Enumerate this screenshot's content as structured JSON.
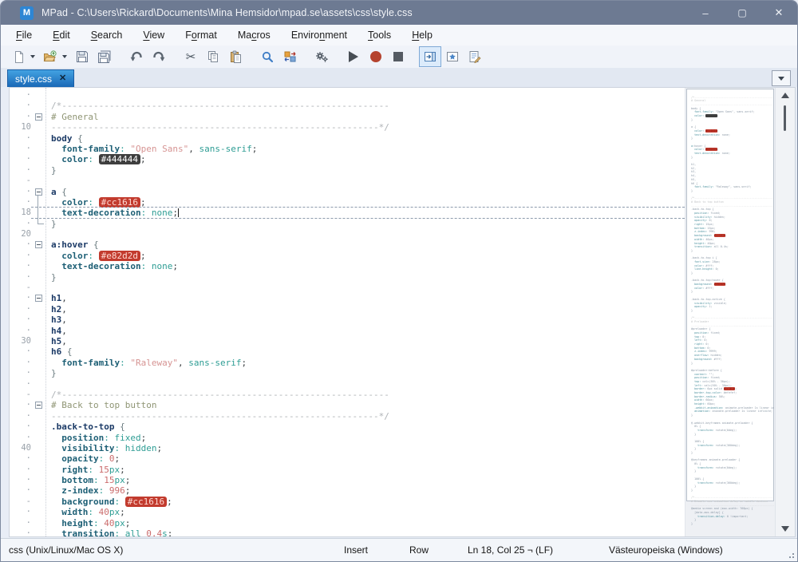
{
  "window": {
    "title": "MPad - C:\\Users\\Rickard\\Documents\\Mina Hemsidor\\mpad.se\\assets\\css\\style.css",
    "logo_text": "M",
    "controls": {
      "minimize": "–",
      "maximize": "▢",
      "close": "✕"
    }
  },
  "menu": {
    "items": [
      {
        "label": "File",
        "underline": 0
      },
      {
        "label": "Edit",
        "underline": 0
      },
      {
        "label": "Search",
        "underline": 0
      },
      {
        "label": "View",
        "underline": 0
      },
      {
        "label": "Format",
        "underline": 1
      },
      {
        "label": "Macros",
        "underline": 2
      },
      {
        "label": "Environment",
        "underline": 6
      },
      {
        "label": "Tools",
        "underline": 0
      },
      {
        "label": "Help",
        "underline": 0
      }
    ]
  },
  "toolbar": {
    "icons": [
      "new-file",
      "new-file-dropdown",
      "open-file",
      "open-file-dropdown",
      "save",
      "save-all",
      "undo",
      "redo",
      "cut",
      "copy",
      "paste",
      "find",
      "replace",
      "macro-settings",
      "run",
      "record-macro",
      "stop",
      "side-panel-toggle",
      "bookmark-panel",
      "edit-settings"
    ]
  },
  "tabbar": {
    "active_tab": "style.css",
    "close_glyph": "✕"
  },
  "editor": {
    "lines": [
      {
        "n": 7,
        "k": []
      },
      {
        "n": 8,
        "k": [
          [
            "c",
            "/*--------------------------------------------------------------"
          ]
        ]
      },
      {
        "n": 9,
        "fold": true,
        "k": [
          [
            "h",
            "# General"
          ]
        ]
      },
      {
        "n": 10,
        "k": [
          [
            "c",
            "--------------------------------------------------------------*/"
          ]
        ]
      },
      {
        "n": 11,
        "k": [
          [
            "e",
            "body"
          ],
          [
            "t",
            " "
          ],
          [
            "b",
            "{"
          ]
        ]
      },
      {
        "n": 12,
        "k": [
          [
            "t",
            "  "
          ],
          [
            "p",
            "font-family"
          ],
          [
            "o",
            ":"
          ],
          [
            "t",
            " "
          ],
          [
            "s",
            "\"Open Sans\""
          ],
          [
            "m",
            ","
          ],
          [
            "t",
            " "
          ],
          [
            "v",
            "sans-serif"
          ],
          [
            "m",
            ";"
          ]
        ]
      },
      {
        "n": 13,
        "k": [
          [
            "t",
            "  "
          ],
          [
            "p",
            "color"
          ],
          [
            "o",
            ":"
          ],
          [
            "t",
            " "
          ],
          [
            "kd",
            "#444444"
          ],
          [
            "m",
            ";"
          ]
        ]
      },
      {
        "n": 14,
        "k": [
          [
            "b",
            "}"
          ]
        ]
      },
      {
        "n": 15,
        "k": []
      },
      {
        "n": 16,
        "fold": true,
        "k": [
          [
            "e",
            "a"
          ],
          [
            "t",
            " "
          ],
          [
            "b",
            "{"
          ]
        ]
      },
      {
        "n": 17,
        "k": [
          [
            "t",
            "  "
          ],
          [
            "p",
            "color"
          ],
          [
            "o",
            ":"
          ],
          [
            "t",
            " "
          ],
          [
            "kr",
            "#cc1616"
          ],
          [
            "m",
            ";"
          ]
        ]
      },
      {
        "n": 18,
        "cur": true,
        "caret": true,
        "k": [
          [
            "t",
            "  "
          ],
          [
            "p",
            "text-decoration"
          ],
          [
            "o",
            ":"
          ],
          [
            "t",
            " "
          ],
          [
            "v",
            "none"
          ],
          [
            "m",
            ";"
          ]
        ]
      },
      {
        "n": 19,
        "k": [
          [
            "b",
            "}"
          ]
        ]
      },
      {
        "n": 20,
        "k": []
      },
      {
        "n": 21,
        "fold": true,
        "k": [
          [
            "e",
            "a:hover"
          ],
          [
            "t",
            " "
          ],
          [
            "b",
            "{"
          ]
        ]
      },
      {
        "n": 22,
        "k": [
          [
            "t",
            "  "
          ],
          [
            "p",
            "color"
          ],
          [
            "o",
            ":"
          ],
          [
            "t",
            " "
          ],
          [
            "kr",
            "#e82d2d"
          ],
          [
            "m",
            ";"
          ]
        ]
      },
      {
        "n": 23,
        "k": [
          [
            "t",
            "  "
          ],
          [
            "p",
            "text-decoration"
          ],
          [
            "o",
            ":"
          ],
          [
            "t",
            " "
          ],
          [
            "v",
            "none"
          ],
          [
            "m",
            ";"
          ]
        ]
      },
      {
        "n": 24,
        "k": [
          [
            "b",
            "}"
          ]
        ]
      },
      {
        "n": 25,
        "k": []
      },
      {
        "n": 26,
        "fold": true,
        "k": [
          [
            "e",
            "h1"
          ],
          [
            "m",
            ","
          ]
        ]
      },
      {
        "n": 27,
        "k": [
          [
            "e",
            "h2"
          ],
          [
            "m",
            ","
          ]
        ]
      },
      {
        "n": 28,
        "k": [
          [
            "e",
            "h3"
          ],
          [
            "m",
            ","
          ]
        ]
      },
      {
        "n": 29,
        "k": [
          [
            "e",
            "h4"
          ],
          [
            "m",
            ","
          ]
        ]
      },
      {
        "n": 30,
        "k": [
          [
            "e",
            "h5"
          ],
          [
            "m",
            ","
          ]
        ]
      },
      {
        "n": 31,
        "k": [
          [
            "e",
            "h6"
          ],
          [
            "t",
            " "
          ],
          [
            "b",
            "{"
          ]
        ]
      },
      {
        "n": 32,
        "k": [
          [
            "t",
            "  "
          ],
          [
            "p",
            "font-family"
          ],
          [
            "o",
            ":"
          ],
          [
            "t",
            " "
          ],
          [
            "s",
            "\"Raleway\""
          ],
          [
            "m",
            ","
          ],
          [
            "t",
            " "
          ],
          [
            "v",
            "sans-serif"
          ],
          [
            "m",
            ";"
          ]
        ]
      },
      {
        "n": 33,
        "k": [
          [
            "b",
            "}"
          ]
        ]
      },
      {
        "n": 34,
        "k": []
      },
      {
        "n": 35,
        "k": [
          [
            "c",
            "/*--------------------------------------------------------------"
          ]
        ]
      },
      {
        "n": 36,
        "fold": true,
        "k": [
          [
            "h",
            "# Back to top button"
          ]
        ]
      },
      {
        "n": 37,
        "k": [
          [
            "c",
            "--------------------------------------------------------------*/"
          ]
        ]
      },
      {
        "n": 38,
        "k": [
          [
            "e",
            ".back-to-top"
          ],
          [
            "t",
            " "
          ],
          [
            "b",
            "{"
          ]
        ]
      },
      {
        "n": 39,
        "k": [
          [
            "t",
            "  "
          ],
          [
            "p",
            "position"
          ],
          [
            "o",
            ":"
          ],
          [
            "t",
            " "
          ],
          [
            "v",
            "fixed"
          ],
          [
            "m",
            ";"
          ]
        ]
      },
      {
        "n": 40,
        "k": [
          [
            "t",
            "  "
          ],
          [
            "p",
            "visibility"
          ],
          [
            "o",
            ":"
          ],
          [
            "t",
            " "
          ],
          [
            "v",
            "hidden"
          ],
          [
            "m",
            ";"
          ]
        ]
      },
      {
        "n": 41,
        "k": [
          [
            "t",
            "  "
          ],
          [
            "p",
            "opacity"
          ],
          [
            "o",
            ":"
          ],
          [
            "t",
            " "
          ],
          [
            "n",
            "0"
          ],
          [
            "m",
            ";"
          ]
        ]
      },
      {
        "n": 42,
        "k": [
          [
            "t",
            "  "
          ],
          [
            "p",
            "right"
          ],
          [
            "o",
            ":"
          ],
          [
            "t",
            " "
          ],
          [
            "n",
            "15"
          ],
          [
            "u",
            "px"
          ],
          [
            "m",
            ";"
          ]
        ]
      },
      {
        "n": 43,
        "k": [
          [
            "t",
            "  "
          ],
          [
            "p",
            "bottom"
          ],
          [
            "o",
            ":"
          ],
          [
            "t",
            " "
          ],
          [
            "n",
            "15"
          ],
          [
            "u",
            "px"
          ],
          [
            "m",
            ";"
          ]
        ]
      },
      {
        "n": 44,
        "k": [
          [
            "t",
            "  "
          ],
          [
            "p",
            "z-index"
          ],
          [
            "o",
            ":"
          ],
          [
            "t",
            " "
          ],
          [
            "n",
            "996"
          ],
          [
            "m",
            ";"
          ]
        ]
      },
      {
        "n": 45,
        "k": [
          [
            "t",
            "  "
          ],
          [
            "p",
            "background"
          ],
          [
            "o",
            ":"
          ],
          [
            "t",
            " "
          ],
          [
            "kr",
            "#cc1616"
          ],
          [
            "m",
            ";"
          ]
        ]
      },
      {
        "n": 46,
        "k": [
          [
            "t",
            "  "
          ],
          [
            "p",
            "width"
          ],
          [
            "o",
            ":"
          ],
          [
            "t",
            " "
          ],
          [
            "n",
            "40"
          ],
          [
            "u",
            "px"
          ],
          [
            "m",
            ";"
          ]
        ]
      },
      {
        "n": 47,
        "k": [
          [
            "t",
            "  "
          ],
          [
            "p",
            "height"
          ],
          [
            "o",
            ":"
          ],
          [
            "t",
            " "
          ],
          [
            "n",
            "40"
          ],
          [
            "u",
            "px"
          ],
          [
            "m",
            ";"
          ]
        ]
      },
      {
        "n": 48,
        "k": [
          [
            "t",
            "  "
          ],
          [
            "p",
            "transition"
          ],
          [
            "o",
            ":"
          ],
          [
            "t",
            " "
          ],
          [
            "v",
            "all"
          ],
          [
            "t",
            " "
          ],
          [
            "n",
            "0.4"
          ],
          [
            "u",
            "s"
          ],
          [
            "m",
            ";"
          ]
        ]
      }
    ]
  },
  "minimap": {
    "lines": [
      "",
      "/*------------------------------------------------------",
      "# General",
      "------------------------------------------------------*/",
      "body {",
      "  font-family: \"Open Sans\", sans-serif;",
      "  color: #444444;",
      "}",
      "",
      "a {",
      "  color: #cc1616;",
      "  text-decoration: none;",
      "}",
      "",
      "a:hover {",
      "  color: #e82d2d;",
      "  text-decoration: none;",
      "}",
      "",
      "h1,",
      "h2,",
      "h3,",
      "h4,",
      "h5,",
      "h6 {",
      "  font-family: \"Raleway\", sans-serif;",
      "}",
      "",
      "/*------------------------------------------------------",
      "# Back to top button",
      "------------------------------------------------------*/",
      ".back-to-top {",
      "  position: fixed;",
      "  visibility: hidden;",
      "  opacity: 0;",
      "  right: 15px;",
      "  bottom: 15px;",
      "  z-index: 996;",
      "  background: #cc1616;",
      "  width: 40px;",
      "  height: 40px;",
      "  transition: all 0.4s;",
      "}",
      "",
      ".back-to-top i {",
      "  font-size: 28px;",
      "  color: #fff;",
      "  line-height: 0;",
      "}",
      "",
      ".back-to-top:hover {",
      "  background: #e82d2d;",
      "  color: #fff;",
      "}",
      "",
      ".back-to-top.active {",
      "  visibility: visible;",
      "  opacity: 1;",
      "}",
      "",
      "/*------------------------------------------------------",
      "# Preloader",
      "------------------------------------------------------*/",
      "#preloader {",
      "  position: fixed;",
      "  top: 0;",
      "  left: 0;",
      "  right: 0;",
      "  bottom: 0;",
      "  z-index: 9999;",
      "  overflow: hidden;",
      "  background: #fff;",
      "}",
      "",
      "#preloader:before {",
      "  content: \"\";",
      "  position: fixed;",
      "  top: calc(50% - 30px);",
      "  left: calc(50% - 30px);",
      "  border: 6px solid #cc1616;",
      "  border-top-color: #efefef;",
      "  border-radius: 50%;",
      "  width: 60px;",
      "  height: 60px;",
      "  -webkit-animation: animate-preloader 1s linear infinite;",
      "  animation: animate-preloader 1s linear infinite;",
      "}",
      "",
      "@-webkit-keyframes animate-preloader {",
      "  0% {",
      "    transform: rotate(0deg);",
      "  }",
      "",
      "  100% {",
      "    transform: rotate(360deg);",
      "  }",
      "}",
      "",
      "@keyframes animate-preloader {",
      "  0% {",
      "    transform: rotate(0deg);",
      "  }",
      "",
      "  100% {",
      "    transform: rotate(360deg);",
      "  }",
      "}",
      "",
      "/*------------------------------------------------------",
      "# Disable aos animation delay on mobile devices",
      "------------------------------------------------------*/",
      "@media screen and (max-width: 768px) {",
      "  [data-aos-delay] {",
      "    transition-delay: 0 !important;",
      "  }",
      "}"
    ]
  },
  "status": {
    "filetype": "css (Unix/Linux/Mac OS X)",
    "insert_mode": "Insert",
    "select_mode": "Row",
    "cursor_position": "Ln 18, Col 25 ¬ (LF)",
    "encoding": "Västeuropeiska (Windows)"
  },
  "colors": {
    "titlebar": "#6d7a92",
    "tab_active_top": "#43a2e2",
    "tab_active_bottom": "#1a68b6",
    "chip_red": "#c23b2e",
    "chip_dark": "#3e3e3e",
    "record_button": "#b5432f"
  }
}
